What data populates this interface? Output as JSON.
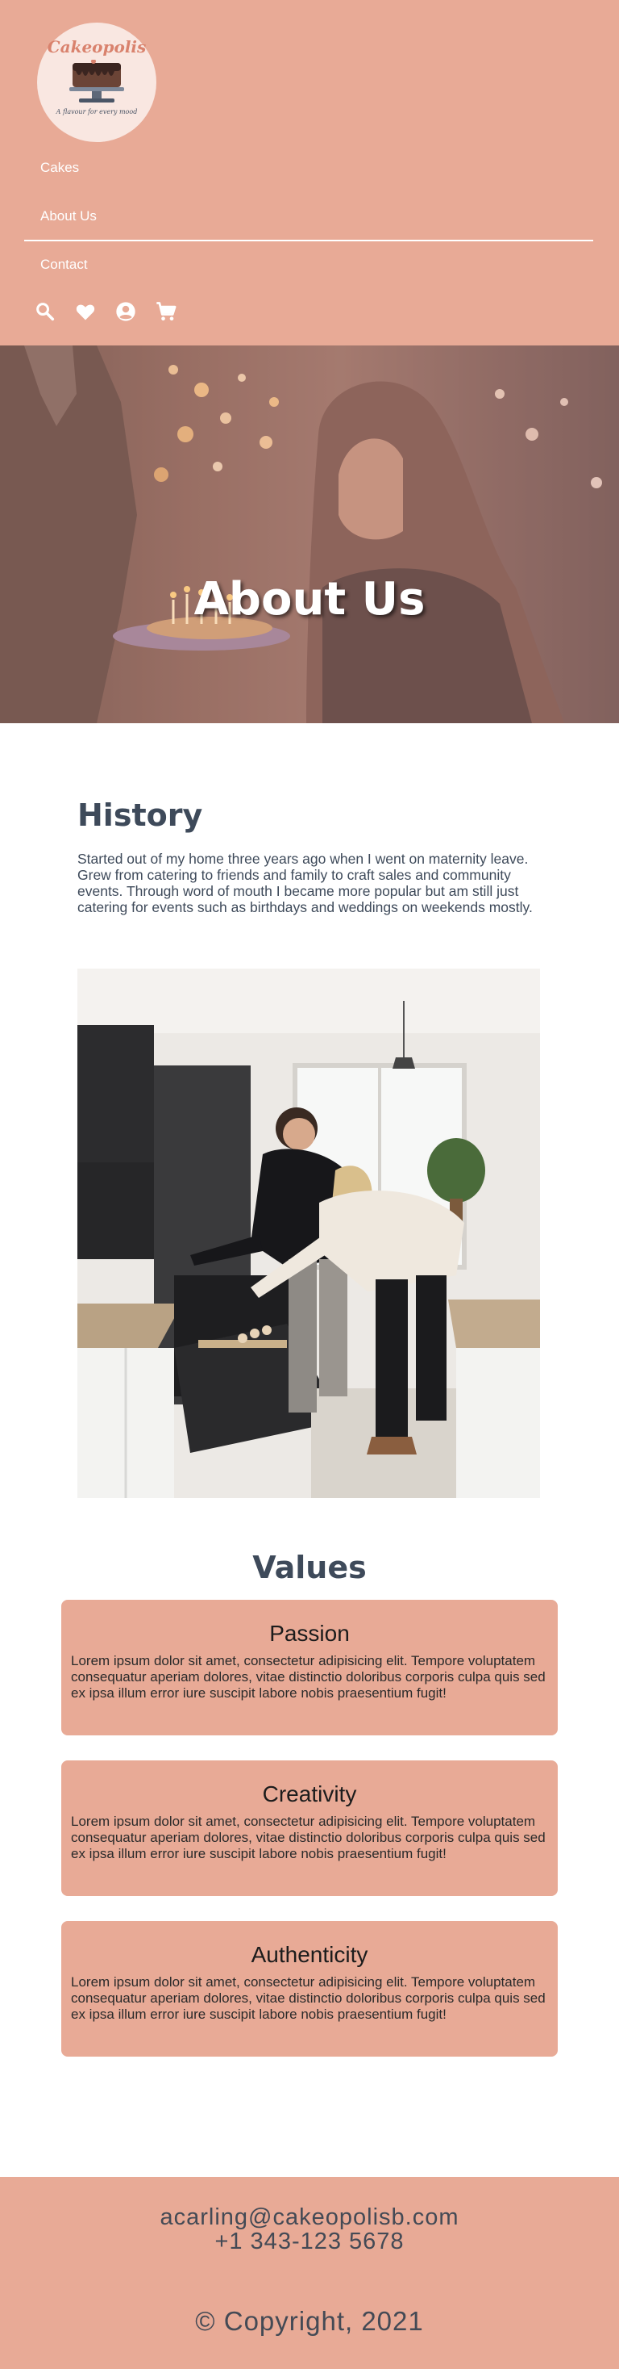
{
  "brand": {
    "name": "Cakeopolis",
    "tagline": "A flavour for every mood"
  },
  "nav": {
    "items": [
      "Cakes",
      "About Us",
      "Contact"
    ],
    "icons": [
      "search-icon",
      "heart-icon",
      "account-icon",
      "cart-icon"
    ]
  },
  "hero": {
    "title": "About Us"
  },
  "history": {
    "title": "History",
    "text": "Started out of my home three years ago when I went on maternity leave. Grew from catering to friends and family to craft sales and community events. Through word of mouth I became more popular but am still just catering for events such as birthdays and weddings on weekends mostly."
  },
  "values": {
    "title": "Values",
    "items": [
      {
        "title": "Passion",
        "text": "Lorem ipsum dolor sit amet, consectetur adipisicing elit. Tempore voluptatem consequatur aperiam dolores, vitae distinctio doloribus corporis culpa quis sed ex ipsa illum error iure suscipit labore nobis praesentium fugit!"
      },
      {
        "title": "Creativity",
        "text": "Lorem ipsum dolor sit amet, consectetur adipisicing elit. Tempore voluptatem consequatur aperiam dolores, vitae distinctio doloribus corporis culpa quis sed ex ipsa illum error iure suscipit labore nobis praesentium fugit!"
      },
      {
        "title": "Authenticity",
        "text": "Lorem ipsum dolor sit amet, consectetur adipisicing elit. Tempore voluptatem consequatur aperiam dolores, vitae distinctio doloribus corporis culpa quis sed ex ipsa illum error iure suscipit labore nobis praesentium fugit!"
      }
    ]
  },
  "footer": {
    "email": "acarling@cakeopolisb.com",
    "phone": "+1 343-123 5678",
    "copyright": "© Copyright, 2021"
  },
  "colors": {
    "accent": "#e8aa96",
    "heading": "#3e4a5a",
    "text": "#3e4a5a"
  }
}
